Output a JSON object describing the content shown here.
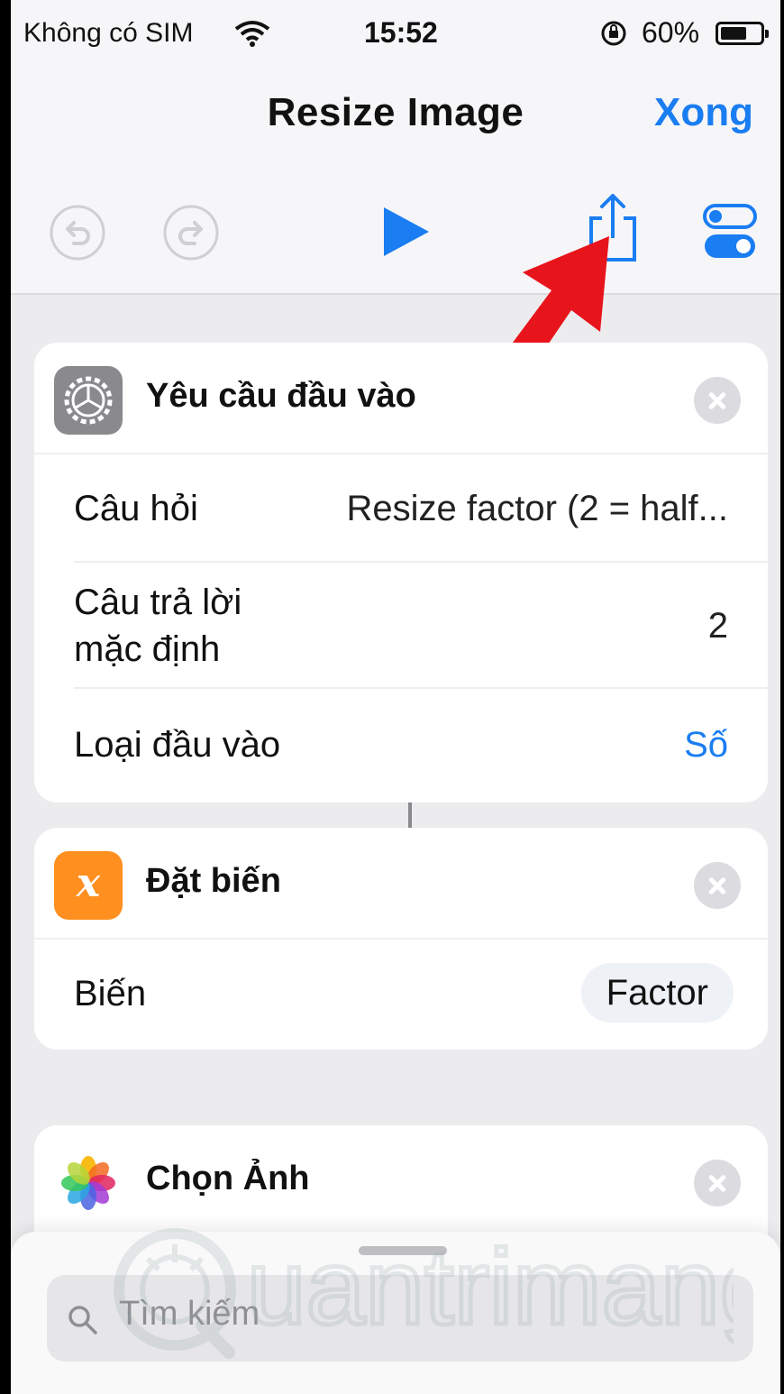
{
  "status_bar": {
    "carrier": "Không có SIM",
    "time": "15:52",
    "battery": "60%"
  },
  "nav": {
    "title": "Resize Image",
    "done": "Xong"
  },
  "actions": [
    {
      "title": "Yêu cầu đầu vào",
      "rows": [
        {
          "label": "Câu hỏi",
          "value": "Resize factor  (2 = half..."
        },
        {
          "label_line1": "Câu trả lời",
          "label_line2": "mặc định",
          "value": "2"
        },
        {
          "label": "Loại đầu vào",
          "value": "Số"
        }
      ]
    },
    {
      "title": "Đặt biến",
      "icon_glyph": "x",
      "rows": [
        {
          "label": "Biến",
          "value": "Factor"
        }
      ]
    },
    {
      "title": "Chọn Ảnh"
    }
  ],
  "search": {
    "placeholder": "Tìm kiếm"
  },
  "watermark": "Quantrimang",
  "colors": {
    "accent": "#1a7df2",
    "arrow": "#e8141b",
    "variable_icon": "#ff8f1f",
    "settings_icon": "#8a8a8e"
  }
}
